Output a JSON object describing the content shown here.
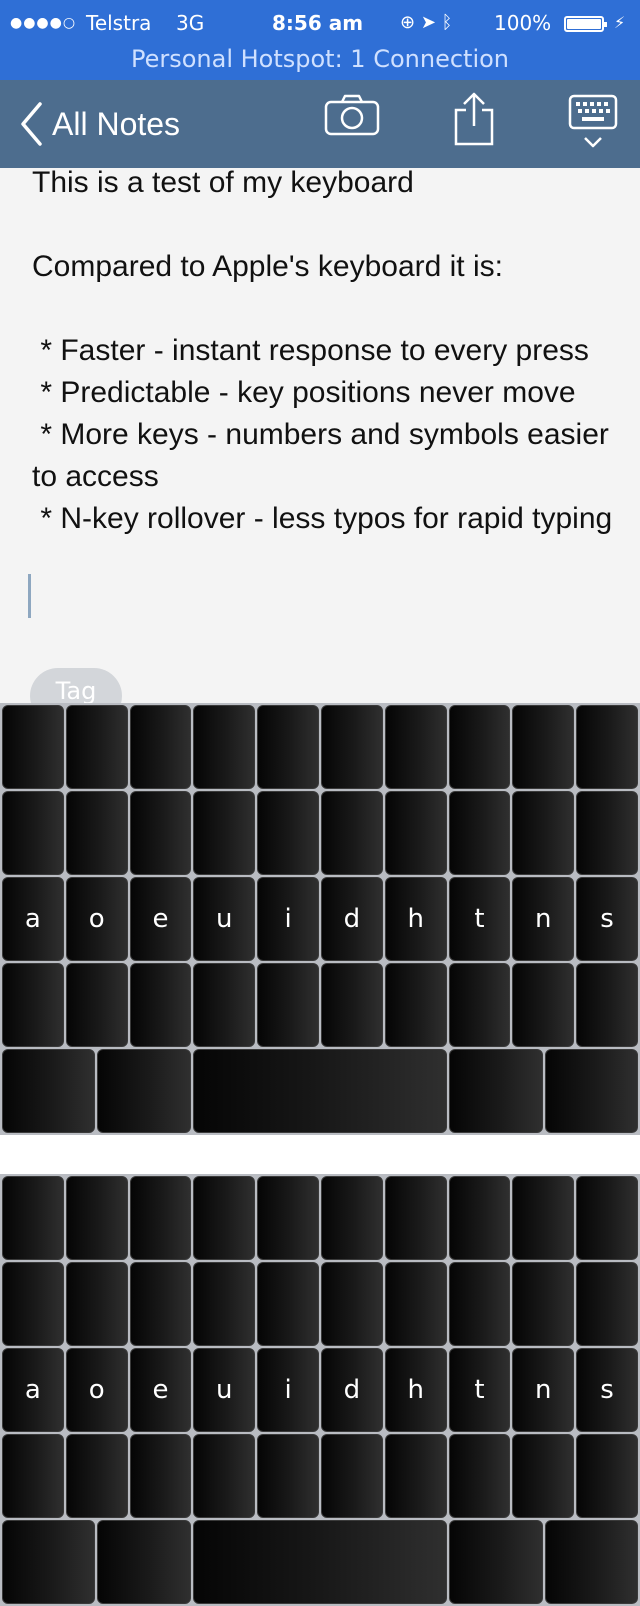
{
  "status_bar": {
    "signal": "●●●●○",
    "carrier": "Telstra",
    "network": "3G",
    "time": "8:56 am",
    "battery_percent": "100%",
    "hotspot": "Personal Hotspot: 1 Connection",
    "bg_color": "#2f6fd6"
  },
  "nav": {
    "back_label": "All Notes",
    "icons": [
      "chevron-left-icon",
      "camera-icon",
      "share-icon",
      "keyboard-hide-icon"
    ],
    "bg_color": "#4d6d8e"
  },
  "note": {
    "text": "This is a test of my keyboard\n\nCompared to Apple's keyboard it is:\n\n * Faster - instant response to every press\n * Predictable - key positions never move\n * More keys - numbers and symbols easier to access\n * N-key rollover - less typos for rapid typing",
    "tag_label": "Tag"
  },
  "keyboard": {
    "home_row": [
      "a",
      "o",
      "e",
      "u",
      "i",
      "d",
      "h",
      "t",
      "n",
      "s"
    ]
  }
}
